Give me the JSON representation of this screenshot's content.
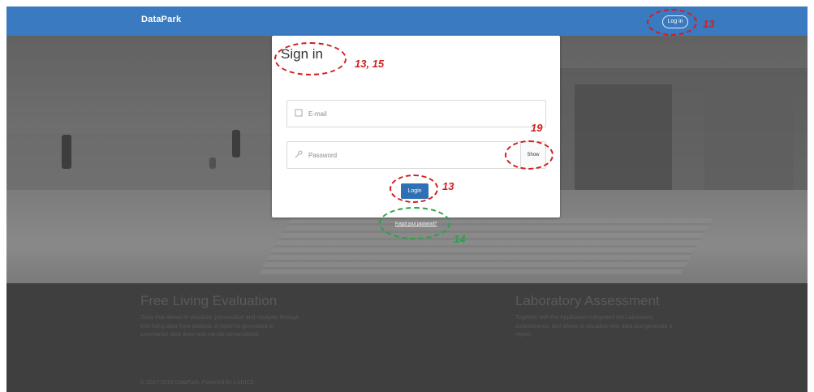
{
  "navbar": {
    "brand": "DataPark",
    "login_label": "Log in"
  },
  "signin": {
    "title": "Sign in",
    "email_placeholder": "E-mail",
    "password_placeholder": "Password",
    "show_label": "Show",
    "login_label": "Login",
    "forgot_label": "Forgot your password?"
  },
  "footer": {
    "left_title": "Free Living Evaluation",
    "left_text": "Tools that allows to visualize, personalize and navigate through free living data from patients. A report is generated to summarize data done and can be personalized.",
    "right_title": "Laboratory Assessment",
    "right_text": "Together with the Application integrated the Laboratory assessments, tool allows to visualize new data and generate a report.",
    "copyright": "© 2017-2018 DataPark. Powered by LUDICE"
  },
  "annotations": {
    "nav_login": "13",
    "title": "13, 15",
    "show": "19",
    "login": "13",
    "forgot": "14"
  },
  "colors": {
    "navbar": "#3a7ac0",
    "primary_button": "#2f6fb3",
    "annotation_red": "#d11f1f",
    "annotation_green": "#27a445"
  }
}
